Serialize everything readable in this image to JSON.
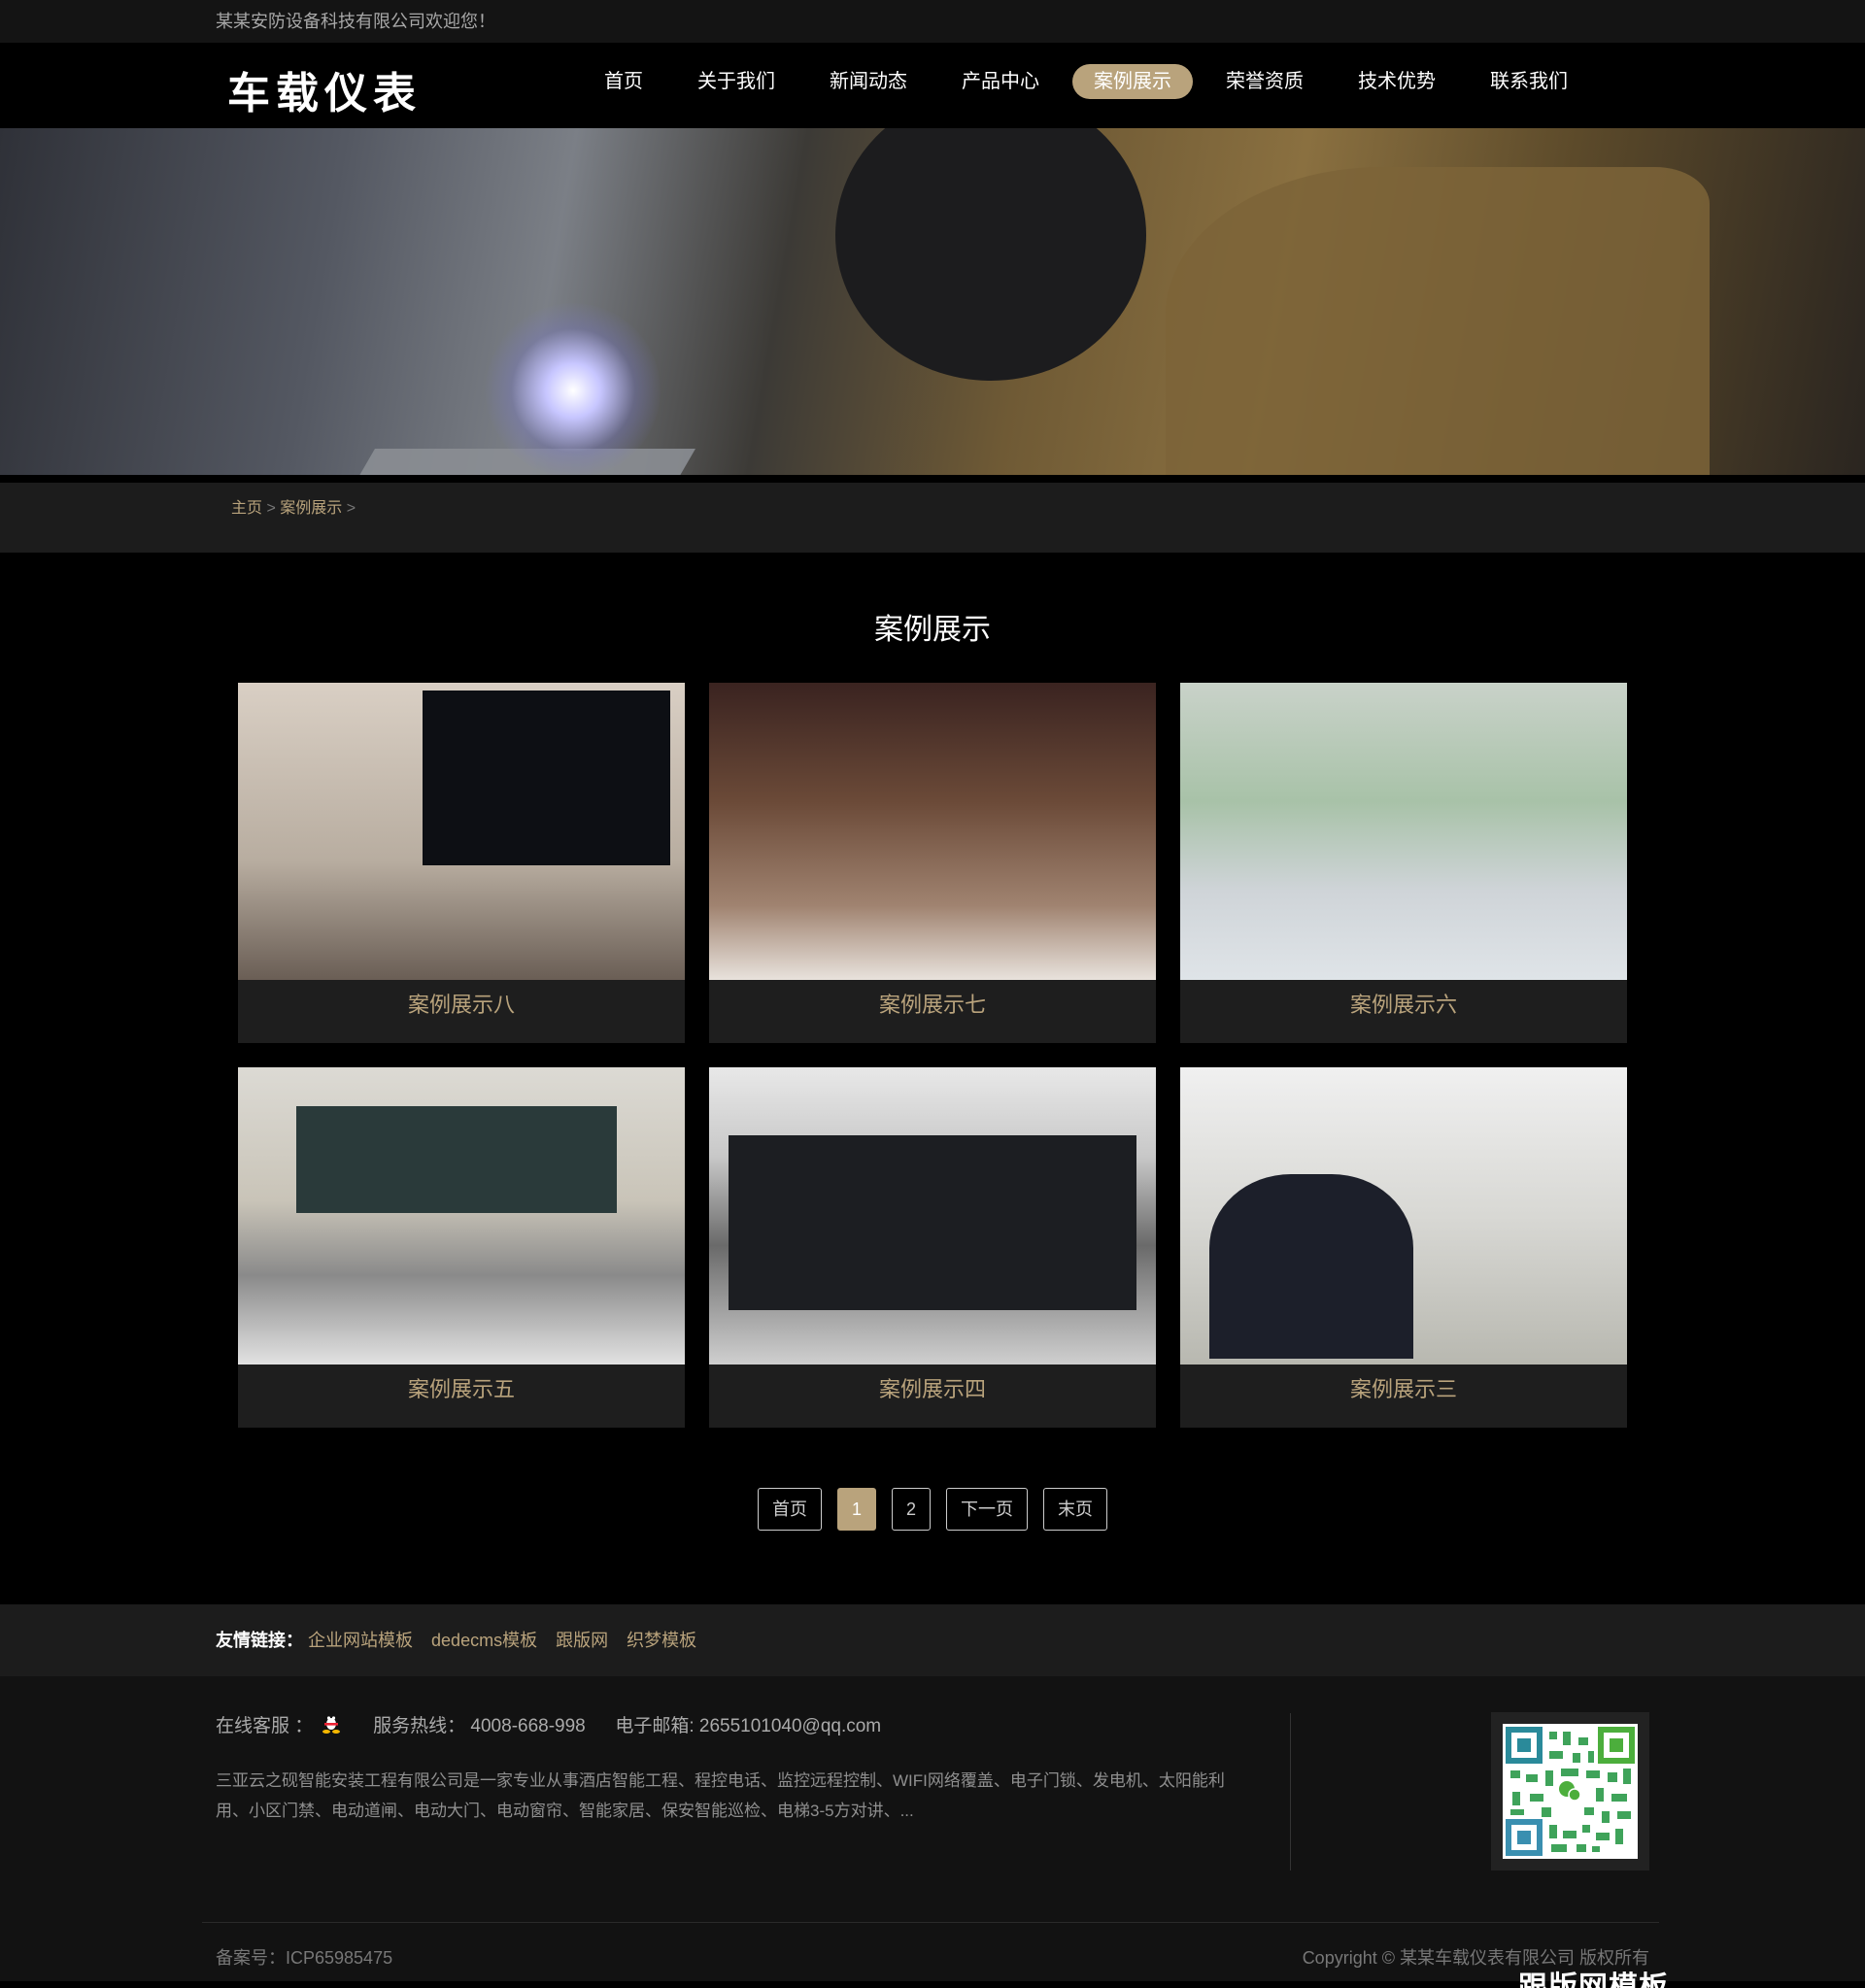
{
  "topbar": {
    "welcome": "某某安防设备科技有限公司欢迎您！"
  },
  "header": {
    "logo": "车载仪表",
    "nav": [
      {
        "label": "首页",
        "active": false
      },
      {
        "label": "关于我们",
        "active": false
      },
      {
        "label": "新闻动态",
        "active": false
      },
      {
        "label": "产品中心",
        "active": false
      },
      {
        "label": "案例展示",
        "active": true
      },
      {
        "label": "荣誉资质",
        "active": false
      },
      {
        "label": "技术优势",
        "active": false
      },
      {
        "label": "联系我们",
        "active": false
      }
    ]
  },
  "breadcrumb": {
    "home": "主页",
    "sep": ">",
    "current": "案例展示"
  },
  "section": {
    "title": "案例展示"
  },
  "cases": [
    {
      "caption": "案例展示八"
    },
    {
      "caption": "案例展示七"
    },
    {
      "caption": "案例展示六"
    },
    {
      "caption": "案例展示五"
    },
    {
      "caption": "案例展示四"
    },
    {
      "caption": "案例展示三"
    }
  ],
  "pagination": {
    "first": "首页",
    "pages": [
      "1",
      "2"
    ],
    "current": "1",
    "next": "下一页",
    "last": "末页"
  },
  "friends": {
    "label": "友情链接：",
    "links": [
      "企业网站模板",
      "dedecms模板",
      "跟版网",
      "织梦模板"
    ]
  },
  "footer": {
    "service_label": "在线客服 ：",
    "hotline_label": "服务热线：",
    "hotline": "4008-668-998",
    "email_label": "电子邮箱:",
    "email": "2655101040@qq.com",
    "description": "三亚云之砚智能安装工程有限公司是一家专业从事酒店智能工程、程控电话、监控远程控制、WIFI网络覆盖、电子门锁、发电机、太阳能利用、小区门禁、电动道闸、电动大门、电动窗帘、智能家居、保安智能巡检、电梯3-5方对讲、...",
    "icp": "备案号：ICP65985475",
    "copyright": "Copyright © 某某车载仪表有限公司 版权所有",
    "watermark": "跟版网模板"
  },
  "colors": {
    "accent": "#b9a37c",
    "bg": "#000000",
    "panel": "#1c1c1c"
  }
}
